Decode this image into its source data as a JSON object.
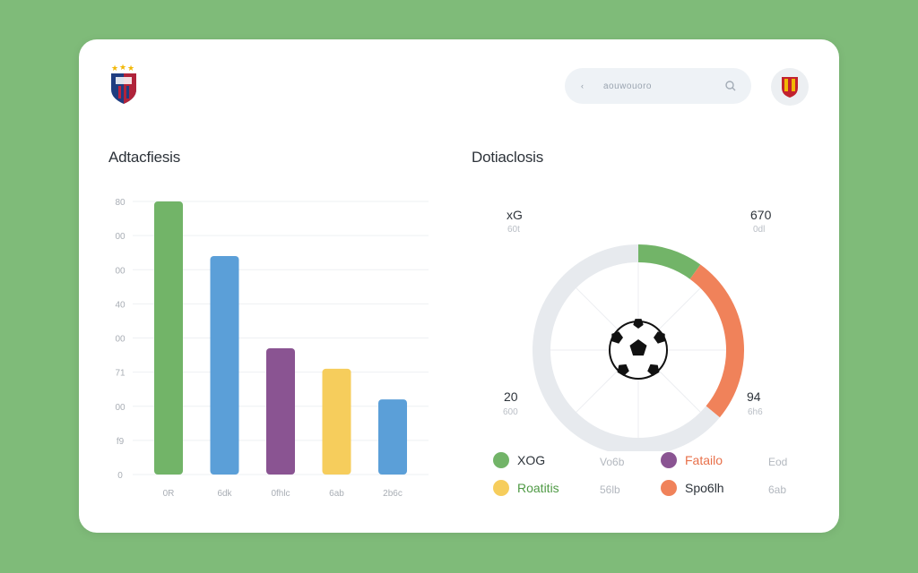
{
  "header": {
    "search_placeholder": "aouwouoro",
    "search_prefix": "‹"
  },
  "left_panel": {
    "title": "Adtacfiesis"
  },
  "right_panel": {
    "title": "Dotiaclosis"
  },
  "chart_data": [
    {
      "type": "bar",
      "title": "Adtacfiesis",
      "categories": [
        "0R",
        "6dk",
        "0fhlc",
        "6ab",
        "2b6c"
      ],
      "values": [
        80,
        64,
        37,
        31,
        22
      ],
      "colors": [
        "#72b468",
        "#5b9fd8",
        "#8a5492",
        "#f6cd5c",
        "#5b9fd8"
      ],
      "y_tick_labels": [
        "80",
        "00",
        "00",
        "40",
        "00",
        "71",
        "00",
        "f9",
        "0"
      ],
      "ylim": [
        0,
        80
      ],
      "grid": true
    },
    {
      "type": "pie",
      "title": "Dotiaclosis",
      "segments": [
        {
          "label": "xG",
          "value": 10,
          "color": "#72b468"
        },
        {
          "label": "",
          "value": 26,
          "color": "#f0825a"
        },
        {
          "label": "",
          "value": 64,
          "color": "#e7eaee"
        }
      ]
    }
  ],
  "donut_labels": [
    {
      "main": "xG",
      "sub": "60t"
    },
    {
      "main": "670",
      "sub": "0dl"
    },
    {
      "main": "20",
      "sub": "600"
    },
    {
      "main": "94",
      "sub": "6h6"
    }
  ],
  "legend": [
    {
      "label": "XOG",
      "value": "Vo6b",
      "color": "#72b468",
      "text_color": "#2d333a"
    },
    {
      "label": "Fatailo",
      "value": "Eod",
      "color": "#8a5492",
      "text_color": "#e8704a"
    },
    {
      "label": "Roatitis",
      "value": "56lb",
      "color": "#f6cd5c",
      "text_color": "#4f9a45"
    },
    {
      "label": "Spo6lh",
      "value": "6ab",
      "color": "#f0825a",
      "text_color": "#2d333a"
    }
  ]
}
